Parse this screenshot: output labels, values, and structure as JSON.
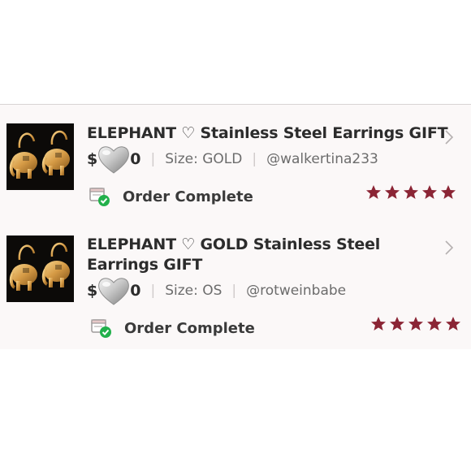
{
  "colors": {
    "star": "#8b2535",
    "status_check": "#22b04b",
    "title_text": "#2c2c2c",
    "meta_text": "#6c6c6c",
    "list_bg": "#fbf8f8"
  },
  "orders": [
    {
      "title": "ELEPHANT ♡ Stainless Steel Earrings GIFT",
      "price_prefix": "$",
      "price_suffix": "0",
      "price_cover_icon": "silver-heart-emoji",
      "size": "Size: GOLD",
      "seller": "@walkertina233",
      "status": "Order Complete",
      "rating": 5
    },
    {
      "title": "ELEPHANT ♡ GOLD Stainless Steel Earrings GIFT",
      "price_prefix": "$",
      "price_suffix": "0",
      "price_cover_icon": "silver-heart-emoji",
      "size": "Size: OS",
      "seller": "@rotweinbabe",
      "status": "Order Complete",
      "rating": 5
    }
  ],
  "icons": {
    "thumbnail": "elephant-earrings-photo",
    "chevron": "chevron-right-icon",
    "status": "order-complete-icon",
    "star": "star-icon"
  }
}
